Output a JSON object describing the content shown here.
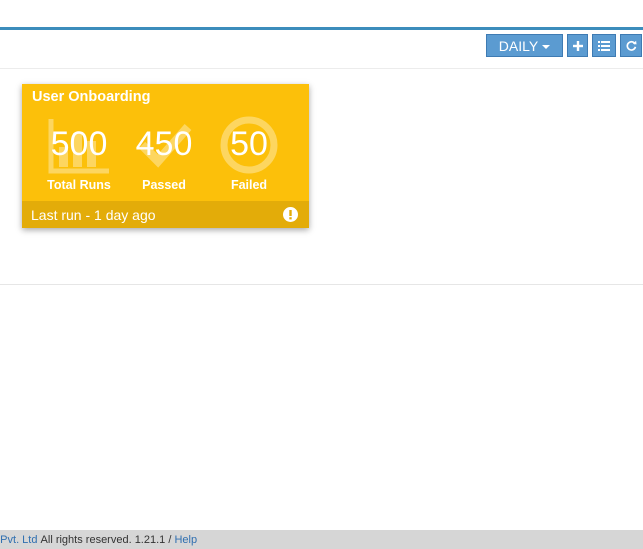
{
  "toolbar": {
    "period_label": "DAILY",
    "add_icon": "plus-icon",
    "list_icon": "list-icon",
    "refresh_icon": "refresh-icon"
  },
  "card": {
    "title": "User Onboarding",
    "accent_color": "#fcc00a",
    "footer_color": "#e3ac09",
    "stats": [
      {
        "value": "500",
        "label": "Total Runs",
        "icon": "chart-icon"
      },
      {
        "value": "450",
        "label": "Passed",
        "icon": "check-icon"
      },
      {
        "value": "50",
        "label": "Failed",
        "icon": "circle-icon"
      }
    ],
    "last_run": "Last run - 1 day ago",
    "status_icon": "exclamation-icon"
  },
  "footer": {
    "company_link": "o Pvt. Ltd",
    "rights": "All rights reserved. 1.21.1 /",
    "help_link": "Help"
  }
}
